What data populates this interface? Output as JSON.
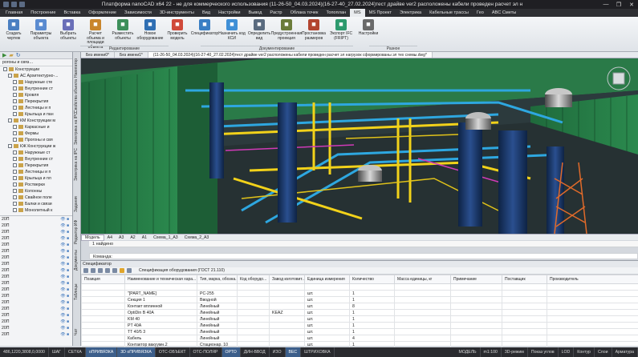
{
  "window": {
    "title": "Платформа nanoCAD x64 22 - не для коммерческого использования (11-26-50_04.03.2024)(16-27-40_27.02.2024)тест драйве ver2 расположены кабели проведен расчет эл н",
    "controls": [
      "—",
      "❐",
      "✕"
    ]
  },
  "ribbon_tabs": [
    "Главная",
    "Построение",
    "Вставка",
    "Оформление",
    "Зависимости",
    "3D-инструменты",
    "Вид",
    "Настройки",
    "Вывод",
    "Растр",
    "Облака точек",
    "Топоплан",
    "MS",
    "MS Проект",
    "Электрика",
    "Кабельные трассы",
    "Гео",
    "ABC Сметы"
  ],
  "active_tab": "MS",
  "ribbon_buttons": [
    {
      "label": "Создать чертеж",
      "icon": "new-drawing-icon",
      "color": "#4a7fc1"
    },
    {
      "label": "Параметры объекта",
      "icon": "object-params-icon",
      "color": "#5a8bd0"
    },
    {
      "label": "Выбрать объекты",
      "icon": "select-objects-icon",
      "color": "#6a6fb8"
    },
    {
      "label": "Расчет объема и площади объекта",
      "icon": "volume-area-icon",
      "color": "#c9862c"
    },
    {
      "label": "Разместить объекты",
      "icon": "place-objects-icon",
      "color": "#3d8f5a"
    },
    {
      "label": "Новое оборудование",
      "icon": "new-equipment-icon",
      "color": "#2f6fb3"
    },
    {
      "label": "Проверить модель",
      "icon": "check-model-icon",
      "color": "#d04a3a"
    },
    {
      "label": "Спецификатор",
      "icon": "specifier-icon",
      "color": "#3a7fc4"
    },
    {
      "label": "Назначить код КСИ",
      "icon": "ksi-code-icon",
      "color": "#3f8fd6"
    },
    {
      "label": "Определить вид",
      "icon": "define-view-icon",
      "color": "#5a6b7f"
    },
    {
      "label": "Предустроенная проекция",
      "icon": "projection-icon",
      "color": "#6b7c3a"
    },
    {
      "label": "Простановка размеров",
      "icon": "dimensions-icon",
      "color": "#b2442f"
    },
    {
      "label": "Экспорт IFC (FRIPT)",
      "icon": "ifc-export-icon",
      "color": "#2d9a6e"
    },
    {
      "label": "Настройки",
      "icon": "settings-icon",
      "color": "#6a6a6a"
    }
  ],
  "ribbon_groups": [
    "Редактирование",
    "Документирование",
    "Разное"
  ],
  "left_panel": {
    "header": "Конструкции",
    "tree": [
      "Конструкции",
      "АС Архитектурно-...",
      "Наружные сте",
      "Внутренние ст",
      "Кровля",
      "Перекрытия",
      "Лестницы и п",
      "Крыльца и пан",
      "КМ Конструкции м",
      "Каркасные и",
      "Фермы",
      "Прогоны и свя",
      "КЖ Конструкции ж",
      "Наружные ст",
      "Внутренние ст",
      "Перекрытия",
      "Лестницы и п",
      "Крыльца и пл",
      "Ростверки",
      "Колонны",
      "Свайное поле",
      "Балки и связи",
      "Монолитный к"
    ],
    "list_label": "20П",
    "list_count": 19
  },
  "side_tabs": [
    "Навигатор",
    "Свойства объекта",
    "Электрика на IPC",
    "Электрика на IPC",
    "Задания",
    "Редактор ИФ",
    "Документы",
    "Таблицы",
    "Чат"
  ],
  "drawing_tabs": [
    "Без имени0*",
    "Без имени1*",
    "(11-26-50_04.03.2024)(16-27-40_27.02.2024)тест драйве ver2 расположены кабели проведен расчет эл нагрузок сформированы эл тех схемы.dwg*"
  ],
  "layout_tabs": [
    "Модель",
    "A4",
    "A3",
    "A2",
    "A1",
    "Схема_1_A3",
    "Схема_2_A3"
  ],
  "found_text": "1 найдено",
  "command_prompt": "Команда:",
  "spec": {
    "panel_title": "Спецификатор",
    "doc_title": "Спецификация оборудования (ГОСТ 21.110)",
    "columns": [
      "Позиция",
      "Наименование и техническая хара...",
      "Тип, марка, обозна...",
      "Код оборудо...",
      "Завод изготовит...",
      "Единица измерения",
      "Количество",
      "Масса единицы, кг",
      "Примечание",
      "Поставщик",
      "Производитель"
    ],
    "rows": [
      [
        "",
        "",
        "",
        "",
        "",
        "",
        "",
        "",
        "",
        "",
        ""
      ],
      [
        "",
        "\"[PART_NAME]",
        "PC-255",
        "",
        "",
        "шт.",
        "1",
        "",
        "",
        "",
        ""
      ],
      [
        "",
        "Секция 1",
        "Вводной",
        "",
        "",
        "шт.",
        "1",
        "",
        "",
        "",
        ""
      ],
      [
        "",
        "Контакт вплинной",
        "Линейный",
        "",
        "",
        "шт.",
        "8",
        "",
        "",
        "",
        ""
      ],
      [
        "",
        "OptiDin B 40A",
        "Линейный",
        "",
        "KEAZ",
        "шт.",
        "1",
        "",
        "",
        "",
        ""
      ],
      [
        "",
        "KM 40",
        "Линейный",
        "",
        "",
        "шт.",
        "1",
        "",
        "",
        "",
        ""
      ],
      [
        "",
        "PT 40A",
        "Линейный",
        "",
        "",
        "шт.",
        "1",
        "",
        "",
        "",
        ""
      ],
      [
        "",
        "TT 40/5 3",
        "Линейный",
        "",
        "",
        "шт.",
        "1",
        "",
        "",
        "",
        ""
      ],
      [
        "",
        "Кабель",
        "Линейный",
        "",
        "",
        "шт.",
        "4",
        "",
        "",
        "",
        ""
      ],
      [
        "",
        "Контактор вакуумн.2",
        "Стационар. 10",
        "",
        "",
        "шт.",
        "1",
        "",
        "",
        "",
        ""
      ]
    ]
  },
  "status_bar": {
    "coords": "486,1220,3808,0,0000",
    "toggles": [
      "ШАГ",
      "СЕТКА",
      "оПРИВЯЗКА",
      "3D оПРИВЯЗКА",
      "ОТС-ОБЪЕКТ",
      "ОТС-ПОЛЯР",
      "ОРТО",
      "ДИН-ВВОД",
      "ИЗО",
      "ВЕС",
      "ШТРИХОВКА"
    ],
    "active_toggles": [
      "оПРИВЯЗКА",
      "3D оПРИВЯЗКА",
      "ОРТО",
      "ВЕС"
    ],
    "model": "МОДЕЛЬ",
    "scale": "m1:100",
    "right": [
      "3D-режим",
      "Показ углов",
      "LOD",
      "Контур",
      "Слои",
      "Арматура"
    ]
  }
}
